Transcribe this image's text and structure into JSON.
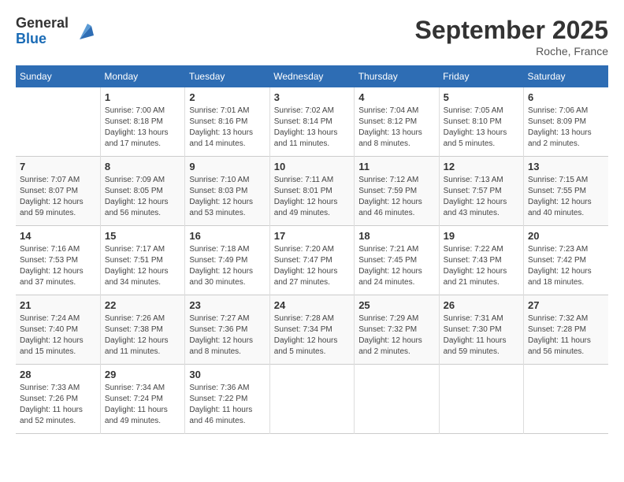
{
  "logo": {
    "general": "General",
    "blue": "Blue"
  },
  "title": "September 2025",
  "location": "Roche, France",
  "days_of_week": [
    "Sunday",
    "Monday",
    "Tuesday",
    "Wednesday",
    "Thursday",
    "Friday",
    "Saturday"
  ],
  "weeks": [
    [
      {
        "day": "",
        "info": ""
      },
      {
        "day": "1",
        "info": "Sunrise: 7:00 AM\nSunset: 8:18 PM\nDaylight: 13 hours\nand 17 minutes."
      },
      {
        "day": "2",
        "info": "Sunrise: 7:01 AM\nSunset: 8:16 PM\nDaylight: 13 hours\nand 14 minutes."
      },
      {
        "day": "3",
        "info": "Sunrise: 7:02 AM\nSunset: 8:14 PM\nDaylight: 13 hours\nand 11 minutes."
      },
      {
        "day": "4",
        "info": "Sunrise: 7:04 AM\nSunset: 8:12 PM\nDaylight: 13 hours\nand 8 minutes."
      },
      {
        "day": "5",
        "info": "Sunrise: 7:05 AM\nSunset: 8:10 PM\nDaylight: 13 hours\nand 5 minutes."
      },
      {
        "day": "6",
        "info": "Sunrise: 7:06 AM\nSunset: 8:09 PM\nDaylight: 13 hours\nand 2 minutes."
      }
    ],
    [
      {
        "day": "7",
        "info": "Sunrise: 7:07 AM\nSunset: 8:07 PM\nDaylight: 12 hours\nand 59 minutes."
      },
      {
        "day": "8",
        "info": "Sunrise: 7:09 AM\nSunset: 8:05 PM\nDaylight: 12 hours\nand 56 minutes."
      },
      {
        "day": "9",
        "info": "Sunrise: 7:10 AM\nSunset: 8:03 PM\nDaylight: 12 hours\nand 53 minutes."
      },
      {
        "day": "10",
        "info": "Sunrise: 7:11 AM\nSunset: 8:01 PM\nDaylight: 12 hours\nand 49 minutes."
      },
      {
        "day": "11",
        "info": "Sunrise: 7:12 AM\nSunset: 7:59 PM\nDaylight: 12 hours\nand 46 minutes."
      },
      {
        "day": "12",
        "info": "Sunrise: 7:13 AM\nSunset: 7:57 PM\nDaylight: 12 hours\nand 43 minutes."
      },
      {
        "day": "13",
        "info": "Sunrise: 7:15 AM\nSunset: 7:55 PM\nDaylight: 12 hours\nand 40 minutes."
      }
    ],
    [
      {
        "day": "14",
        "info": "Sunrise: 7:16 AM\nSunset: 7:53 PM\nDaylight: 12 hours\nand 37 minutes."
      },
      {
        "day": "15",
        "info": "Sunrise: 7:17 AM\nSunset: 7:51 PM\nDaylight: 12 hours\nand 34 minutes."
      },
      {
        "day": "16",
        "info": "Sunrise: 7:18 AM\nSunset: 7:49 PM\nDaylight: 12 hours\nand 30 minutes."
      },
      {
        "day": "17",
        "info": "Sunrise: 7:20 AM\nSunset: 7:47 PM\nDaylight: 12 hours\nand 27 minutes."
      },
      {
        "day": "18",
        "info": "Sunrise: 7:21 AM\nSunset: 7:45 PM\nDaylight: 12 hours\nand 24 minutes."
      },
      {
        "day": "19",
        "info": "Sunrise: 7:22 AM\nSunset: 7:43 PM\nDaylight: 12 hours\nand 21 minutes."
      },
      {
        "day": "20",
        "info": "Sunrise: 7:23 AM\nSunset: 7:42 PM\nDaylight: 12 hours\nand 18 minutes."
      }
    ],
    [
      {
        "day": "21",
        "info": "Sunrise: 7:24 AM\nSunset: 7:40 PM\nDaylight: 12 hours\nand 15 minutes."
      },
      {
        "day": "22",
        "info": "Sunrise: 7:26 AM\nSunset: 7:38 PM\nDaylight: 12 hours\nand 11 minutes."
      },
      {
        "day": "23",
        "info": "Sunrise: 7:27 AM\nSunset: 7:36 PM\nDaylight: 12 hours\nand 8 minutes."
      },
      {
        "day": "24",
        "info": "Sunrise: 7:28 AM\nSunset: 7:34 PM\nDaylight: 12 hours\nand 5 minutes."
      },
      {
        "day": "25",
        "info": "Sunrise: 7:29 AM\nSunset: 7:32 PM\nDaylight: 12 hours\nand 2 minutes."
      },
      {
        "day": "26",
        "info": "Sunrise: 7:31 AM\nSunset: 7:30 PM\nDaylight: 11 hours\nand 59 minutes."
      },
      {
        "day": "27",
        "info": "Sunrise: 7:32 AM\nSunset: 7:28 PM\nDaylight: 11 hours\nand 56 minutes."
      }
    ],
    [
      {
        "day": "28",
        "info": "Sunrise: 7:33 AM\nSunset: 7:26 PM\nDaylight: 11 hours\nand 52 minutes."
      },
      {
        "day": "29",
        "info": "Sunrise: 7:34 AM\nSunset: 7:24 PM\nDaylight: 11 hours\nand 49 minutes."
      },
      {
        "day": "30",
        "info": "Sunrise: 7:36 AM\nSunset: 7:22 PM\nDaylight: 11 hours\nand 46 minutes."
      },
      {
        "day": "",
        "info": ""
      },
      {
        "day": "",
        "info": ""
      },
      {
        "day": "",
        "info": ""
      },
      {
        "day": "",
        "info": ""
      }
    ]
  ]
}
